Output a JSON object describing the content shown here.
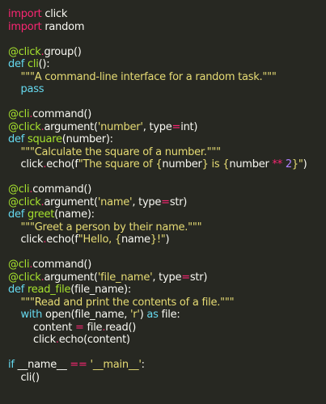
{
  "colors": {
    "background": "#272822",
    "keyword": "#f92672",
    "plain": "#f8f8f2",
    "decorator": "#a6e22e",
    "builtin": "#66d9ef",
    "string": "#e6db74",
    "number": "#ae81ff"
  },
  "lines": [
    [
      [
        "k",
        "import"
      ],
      [
        "n",
        " click"
      ]
    ],
    [
      [
        "k",
        "import"
      ],
      [
        "n",
        " random"
      ]
    ],
    [],
    [
      [
        "d",
        "@click"
      ],
      [
        "k",
        "."
      ],
      [
        "n",
        "group()"
      ]
    ],
    [
      [
        "c",
        "def"
      ],
      [
        "n",
        " "
      ],
      [
        "d",
        "cli"
      ],
      [
        "n",
        "():"
      ]
    ],
    [
      [
        "n",
        "    "
      ],
      [
        "s",
        "\"\"\"A command-line interface for a random task.\"\"\""
      ]
    ],
    [
      [
        "n",
        "    "
      ],
      [
        "c",
        "pass"
      ]
    ],
    [],
    [
      [
        "d",
        "@cli"
      ],
      [
        "k",
        "."
      ],
      [
        "n",
        "command()"
      ]
    ],
    [
      [
        "d",
        "@click"
      ],
      [
        "k",
        "."
      ],
      [
        "n",
        "argument("
      ],
      [
        "s",
        "'number'"
      ],
      [
        "n",
        ", type"
      ],
      [
        "k",
        "="
      ],
      [
        "n",
        "int)"
      ]
    ],
    [
      [
        "c",
        "def"
      ],
      [
        "n",
        " "
      ],
      [
        "d",
        "square"
      ],
      [
        "n",
        "(number):"
      ]
    ],
    [
      [
        "n",
        "    "
      ],
      [
        "s",
        "\"\"\"Calculate the square of a number.\"\"\""
      ]
    ],
    [
      [
        "n",
        "    click"
      ],
      [
        "k",
        "."
      ],
      [
        "n",
        "echo(f"
      ],
      [
        "s",
        "\"The square of {"
      ],
      [
        "n",
        "number"
      ],
      [
        "s",
        "} is {"
      ],
      [
        "n",
        "number "
      ],
      [
        "k",
        "**"
      ],
      [
        "n",
        " "
      ],
      [
        "m",
        "2"
      ],
      [
        "s",
        "}\""
      ],
      [
        "n",
        ")"
      ]
    ],
    [],
    [
      [
        "d",
        "@cli"
      ],
      [
        "k",
        "."
      ],
      [
        "n",
        "command()"
      ]
    ],
    [
      [
        "d",
        "@click"
      ],
      [
        "k",
        "."
      ],
      [
        "n",
        "argument("
      ],
      [
        "s",
        "'name'"
      ],
      [
        "n",
        ", type"
      ],
      [
        "k",
        "="
      ],
      [
        "n",
        "str)"
      ]
    ],
    [
      [
        "c",
        "def"
      ],
      [
        "n",
        " "
      ],
      [
        "d",
        "greet"
      ],
      [
        "n",
        "(name):"
      ]
    ],
    [
      [
        "n",
        "    "
      ],
      [
        "s",
        "\"\"\"Greet a person by their name.\"\"\""
      ]
    ],
    [
      [
        "n",
        "    click"
      ],
      [
        "k",
        "."
      ],
      [
        "n",
        "echo(f"
      ],
      [
        "s",
        "\"Hello, {"
      ],
      [
        "n",
        "name"
      ],
      [
        "s",
        "}!\""
      ],
      [
        "n",
        ")"
      ]
    ],
    [],
    [
      [
        "d",
        "@cli"
      ],
      [
        "k",
        "."
      ],
      [
        "n",
        "command()"
      ]
    ],
    [
      [
        "d",
        "@click"
      ],
      [
        "k",
        "."
      ],
      [
        "n",
        "argument("
      ],
      [
        "s",
        "'file_name'"
      ],
      [
        "n",
        ", type"
      ],
      [
        "k",
        "="
      ],
      [
        "n",
        "str)"
      ]
    ],
    [
      [
        "c",
        "def"
      ],
      [
        "n",
        " "
      ],
      [
        "d",
        "read_file"
      ],
      [
        "n",
        "(file_name):"
      ]
    ],
    [
      [
        "n",
        "    "
      ],
      [
        "s",
        "\"\"\"Read and print the contents of a file.\"\"\""
      ]
    ],
    [
      [
        "n",
        "    "
      ],
      [
        "c",
        "with"
      ],
      [
        "n",
        " open(file_name, "
      ],
      [
        "s",
        "'r'"
      ],
      [
        "n",
        ") "
      ],
      [
        "c",
        "as"
      ],
      [
        "n",
        " file:"
      ]
    ],
    [
      [
        "n",
        "        content "
      ],
      [
        "k",
        "="
      ],
      [
        "n",
        " file"
      ],
      [
        "k",
        "."
      ],
      [
        "n",
        "read()"
      ]
    ],
    [
      [
        "n",
        "        click"
      ],
      [
        "k",
        "."
      ],
      [
        "n",
        "echo(content)"
      ]
    ],
    [],
    [
      [
        "c",
        "if"
      ],
      [
        "n",
        " __name__ "
      ],
      [
        "k",
        "=="
      ],
      [
        "n",
        " "
      ],
      [
        "s",
        "'__main__'"
      ],
      [
        "n",
        ":"
      ]
    ],
    [
      [
        "n",
        "    cli()"
      ]
    ]
  ]
}
